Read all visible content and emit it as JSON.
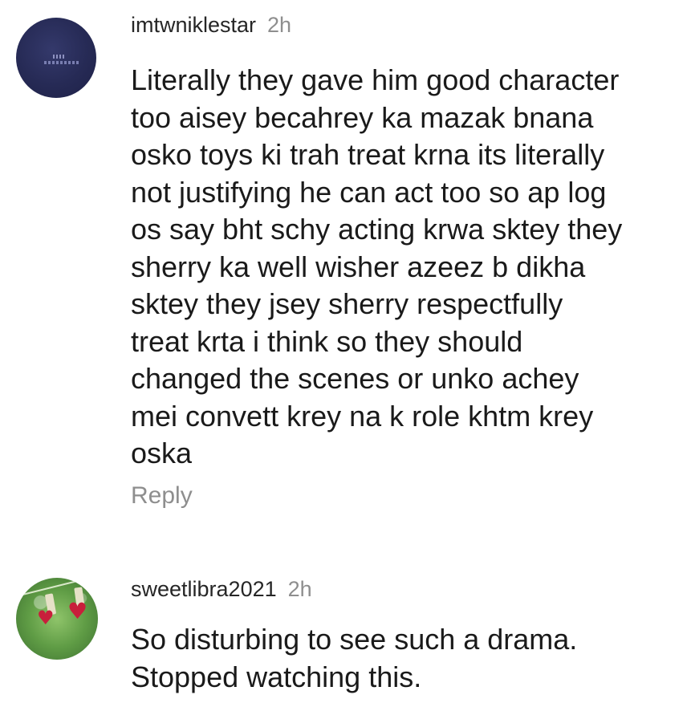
{
  "comments": [
    {
      "username": "imtwniklestar",
      "time": "2h",
      "text": "Literally they gave him good character\ntoo aisey becahrey ka mazak bnana\nosko toys ki trah treat krna its literally\nnot justifying he can act too so ap log\nos say bht schy acting krwa sktey they\nsherry ka well wisher azeez b dikha\nsktey they jsey sherry respectfully\ntreat krta i think so they should\nchanged the scenes or unko achey\nmei convett krey na k role khtm krey\noska",
      "reply_label": "Reply",
      "avatar_icon": "dark-blue-logo-avatar"
    },
    {
      "username": "sweetlibra2021",
      "time": "2h",
      "text": "So disturbing to see such a drama.\nStopped watching this.",
      "avatar_icon": "hearts-on-clothesline-avatar"
    }
  ],
  "colors": {
    "username": "#262626",
    "time": "#8e8e8e",
    "body": "#1a1a1a",
    "reply": "#8e8e8e",
    "background": "#ffffff"
  }
}
